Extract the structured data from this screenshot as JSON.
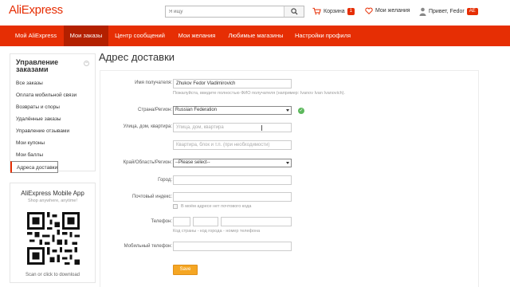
{
  "header": {
    "logo": "AliExpress",
    "search_placeholder": "Я ищу",
    "cart_label": "Корзина",
    "cart_count": "1",
    "wishlist_label": "Мои желания",
    "greeting": "Привет, Fedor",
    "account_badge": "AE"
  },
  "nav": {
    "items": [
      "Мой AliExpress",
      "Мои заказы",
      "Центр сообщений",
      "Мои желания",
      "Любимые магазины",
      "Настройки профиля"
    ],
    "active": "Мои заказы"
  },
  "sidebar": {
    "title": "Управление заказами",
    "collapse_glyph": "−",
    "items": [
      "Все заказы",
      "Оплата мобильной связи",
      "Возвраты и споры",
      "Удалённые заказы",
      "Управление отзывами",
      "Мои купоны",
      "Мои баллы",
      "Адреса доставки"
    ],
    "selected": "Адреса доставки"
  },
  "app_promo": {
    "title": "AliExpress Mobile App",
    "subtitle": "Shop anywhere, anytime!",
    "cta": "Scan or click to download"
  },
  "page": {
    "title": "Адрес доставки"
  },
  "form": {
    "recipient_label": "Имя получателя:",
    "recipient_value": "Zhukov Fedor Vladimirovich",
    "recipient_hint": "Пожалуйста, введите полностью ФИО получателя (например: Ivanov Ivan Ivanovich).",
    "country_label": "Страна/Регион:",
    "country_value": "Russian Federation",
    "country_ok_glyph": "✓",
    "street_label": "Улица, дом, квартира:",
    "street_placeholder": "Улица, дом, квартира",
    "apt_placeholder": "Квартира, блок и т.п. (при необходимости)",
    "region_label": "Край/Область/Регион:",
    "region_value": "--Please select--",
    "city_label": "Город:",
    "zip_label": "Почтовый индекс:",
    "zip_checkbox_label": "В моём адресе нет почтового кода",
    "phone_label": "Телефон:",
    "phone_hint": "Код страны - код города - номер телефона",
    "mobile_label": "Мобильный телефон:",
    "save_label": "Save"
  },
  "colors": {
    "brand": "#e62e04",
    "nav_active": "#b32000",
    "save": "#f5a623",
    "ok": "#5cb85c"
  }
}
